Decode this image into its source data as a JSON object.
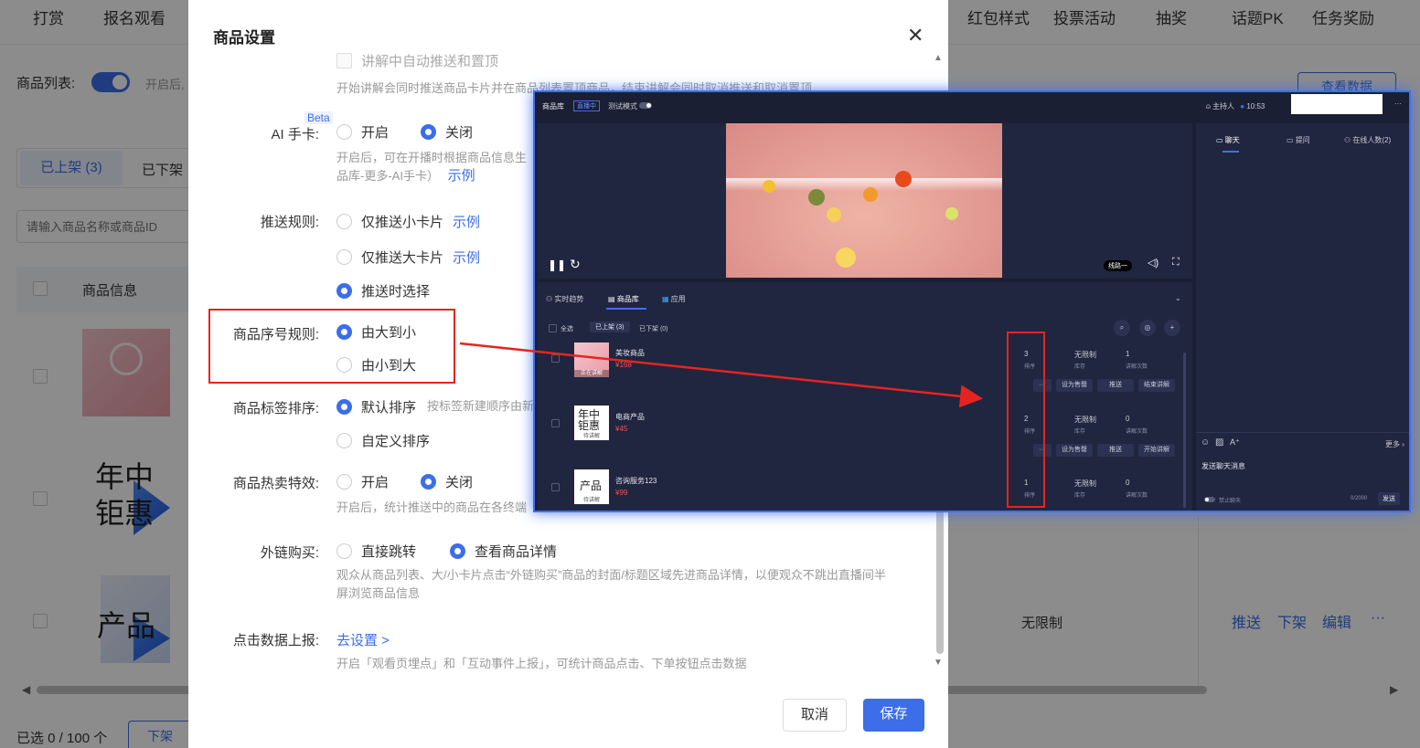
{
  "background": {
    "nav": [
      "打赏",
      "报名观看",
      "红包样式",
      "投票活动",
      "抽奖",
      "话题PK",
      "任务奖励"
    ],
    "product_list_label": "商品列表:",
    "product_list_hint": "开启后,",
    "view_data_button": "查看数据",
    "tabs": [
      "已上架 (3)",
      "已下架"
    ],
    "search_placeholder": "请输入商品名称或商品ID",
    "column_product_info": "商品信息",
    "thumb_texts": [
      "年中\n钜惠",
      "产品"
    ],
    "row_stock": "无限制",
    "row_actions": [
      "推送",
      "下架",
      "编辑",
      "···"
    ],
    "footer_selected": "已选 0 / 100 个",
    "footer_button": "下架"
  },
  "modal": {
    "title": "商品设置",
    "close_glyph": "✕",
    "auto_push_label": "讲解中自动推送和置顶",
    "auto_push_hint": "开始讲解会同时推送商品卡片并在商品列表置顶商品，结束讲解会同时取消推送和取消置顶",
    "ai_card": {
      "label": "AI 手卡:",
      "beta": "Beta",
      "options": [
        "开启",
        "关闭"
      ],
      "selected": 1,
      "hint_line1": "开启后，可在开播时根据商品信息生",
      "hint_line2": "品库-更多-AI手卡）",
      "example": "示例"
    },
    "push_rule": {
      "label": "推送规则:",
      "options": [
        "仅推送小卡片",
        "仅推送大卡片",
        "推送时选择"
      ],
      "selected": 2,
      "example": "示例"
    },
    "sort_rule": {
      "label": "商品序号规则:",
      "options": [
        "由大到小",
        "由小到大"
      ],
      "selected": 0
    },
    "tag_sort": {
      "label": "商品标签排序:",
      "options": [
        "默认排序",
        "自定义排序"
      ],
      "selected": 0,
      "hint": "按标签新建顺序由新"
    },
    "hot_effect": {
      "label": "商品热卖特效:",
      "options": [
        "开启",
        "关闭"
      ],
      "selected": 1,
      "hint": "开启后，统计推送中的商品在各终端"
    },
    "external_link": {
      "label": "外链购买:",
      "options": [
        "直接跳转",
        "查看商品详情"
      ],
      "selected": 1,
      "hint_line1": "观众从商品列表、大/小卡片点击“外链购买”商品的封面/标题区域先进商品详情，以便观众不跳出直播间半",
      "hint_line2": "屏浏览商品信息"
    },
    "click_report": {
      "label": "点击数据上报:",
      "link": "去设置 >",
      "hint": "开启「观看页埋点」和「互动事件上报」，可统计商品点击、下单按钮点击数据"
    },
    "cancel": "取消",
    "save": "保存"
  },
  "studio": {
    "title": "商品库",
    "live_badge": "直播中",
    "test_mode": "测试模式",
    "host": "主持人",
    "time": "10:53",
    "more": "···",
    "line_label": "线路一",
    "tabs": [
      "实时趋势",
      "商品库",
      "应用"
    ],
    "select_all": "全选",
    "sub_tabs": [
      "已上架 (3)",
      "已下架 (0)"
    ],
    "products": [
      {
        "name": "美妆商品",
        "price": "¥168",
        "order": "3",
        "stock": "无限制",
        "count": "1",
        "tag": "正在讲解",
        "actions": [
          "设为售罄",
          "推送",
          "结束讲解"
        ]
      },
      {
        "name": "电商产品",
        "price": "¥45",
        "order": "2",
        "stock": "无限制",
        "count": "0",
        "tag": "待讲解",
        "thumb": "年中\n钜惠",
        "actions": [
          "设为售罄",
          "推送",
          "开始讲解"
        ]
      },
      {
        "name": "咨询服务123",
        "price": "¥99",
        "order": "1",
        "stock": "无限制",
        "count": "0",
        "tag": "待讲解",
        "thumb": "产品"
      }
    ],
    "order_label": "排序",
    "stock_label": "库存",
    "count_label": "讲解次数",
    "chat_tabs": [
      "聊天",
      "提问",
      "在线人数(2)"
    ],
    "chat_more": "更多",
    "chat_placeholder": "发送聊天消息",
    "mute_label": "禁止聊天",
    "char_count": "0/2000",
    "send": "发送"
  },
  "colors": {
    "accent": "#3b6ee8",
    "annotation_red": "#e52420",
    "studio_bg": "#1a1f33"
  }
}
